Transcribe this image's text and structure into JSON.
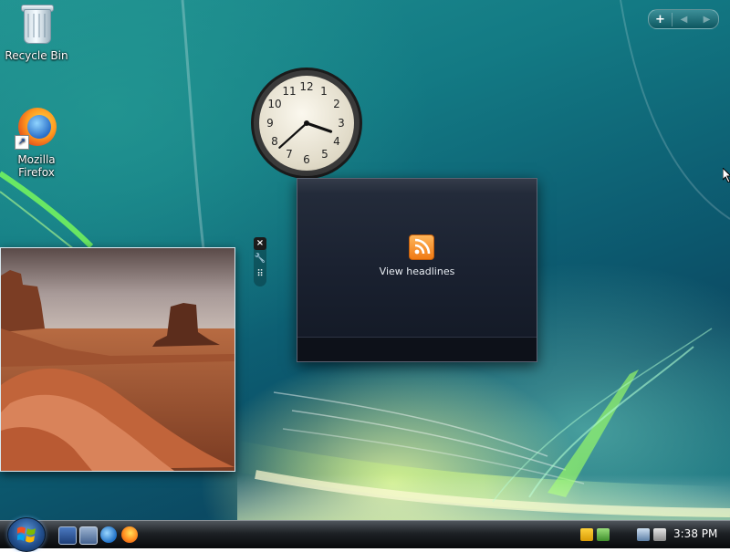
{
  "desktop": {
    "icons": [
      {
        "label": "Recycle Bin",
        "icon": "recycle-bin-icon"
      },
      {
        "label": "Mozilla Firefox",
        "icon": "firefox-icon"
      }
    ]
  },
  "sidebar": {
    "add_glyph": "+",
    "prev_glyph": "◀",
    "next_glyph": "▶"
  },
  "clock_gadget": {
    "numerals": [
      "12",
      "1",
      "2",
      "3",
      "4",
      "5",
      "6",
      "7",
      "8",
      "9",
      "10",
      "11"
    ],
    "time": "3:38"
  },
  "feed_gadget": {
    "icon": "rss-icon",
    "label": "View headlines"
  },
  "gadget_toolbar": {
    "close_glyph": "×",
    "options_glyph": "🔧",
    "drag_glyph": "⠿"
  },
  "taskbar": {
    "start_icon": "windows-logo-icon",
    "quick_launch": [
      "show-desktop-icon",
      "switch-windows-icon",
      "internet-explorer-icon",
      "firefox-icon"
    ],
    "tray_icons": [
      "security-shield-icon",
      "safely-remove-icon",
      "network-icon",
      "volume-muted-icon"
    ],
    "clock": "3:38 PM"
  },
  "colors": {
    "taskbar": "#1d2125",
    "rss_orange": "#f07a14",
    "feed_background": "#1a2130"
  }
}
